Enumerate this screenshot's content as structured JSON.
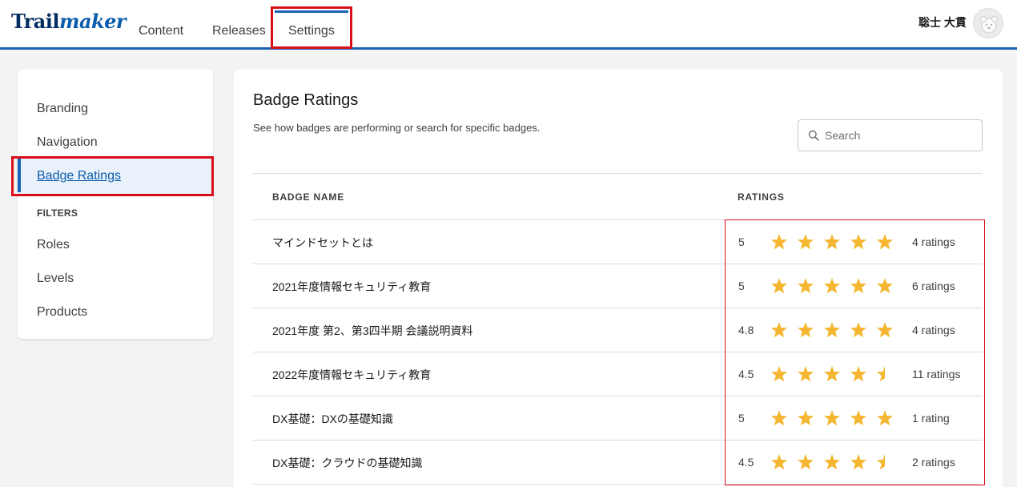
{
  "header": {
    "logo_part1": "Trail",
    "logo_part2": "maker",
    "tabs": [
      {
        "label": "Content"
      },
      {
        "label": "Releases"
      },
      {
        "label": "Settings"
      }
    ],
    "user_name": "聡士 大貫"
  },
  "sidebar": {
    "items": [
      {
        "label": "Branding"
      },
      {
        "label": "Navigation"
      },
      {
        "label": "Badge Ratings"
      }
    ],
    "filters_title": "FILTERS",
    "filters": [
      {
        "label": "Roles"
      },
      {
        "label": "Levels"
      },
      {
        "label": "Products"
      }
    ]
  },
  "main": {
    "title": "Badge Ratings",
    "description": "See how badges are performing or search for specific badges.",
    "search_placeholder": "Search",
    "columns": [
      "BADGE NAME",
      "RATINGS"
    ],
    "rows": [
      {
        "name": "マインドセットとは",
        "score": "5",
        "stars": 5,
        "count": "4 ratings"
      },
      {
        "name": "2021年度情報セキュリティ教育",
        "score": "5",
        "stars": 5,
        "count": "6 ratings"
      },
      {
        "name": "2021年度 第2、第3四半期 会議説明資料",
        "score": "4.8",
        "stars": 5,
        "count": "4 ratings"
      },
      {
        "name": "2022年度情報セキュリティ教育",
        "score": "4.5",
        "stars": 4.5,
        "count": "11 ratings"
      },
      {
        "name": "DX基礎：DXの基礎知識",
        "score": "5",
        "stars": 5,
        "count": "1 rating"
      },
      {
        "name": "DX基礎：クラウドの基礎知識",
        "score": "4.5",
        "stars": 4.5,
        "count": "2 ratings"
      }
    ]
  },
  "colors": {
    "accent": "#1b63b5",
    "star": "#f5b731",
    "highlight": "#d80f1a"
  }
}
